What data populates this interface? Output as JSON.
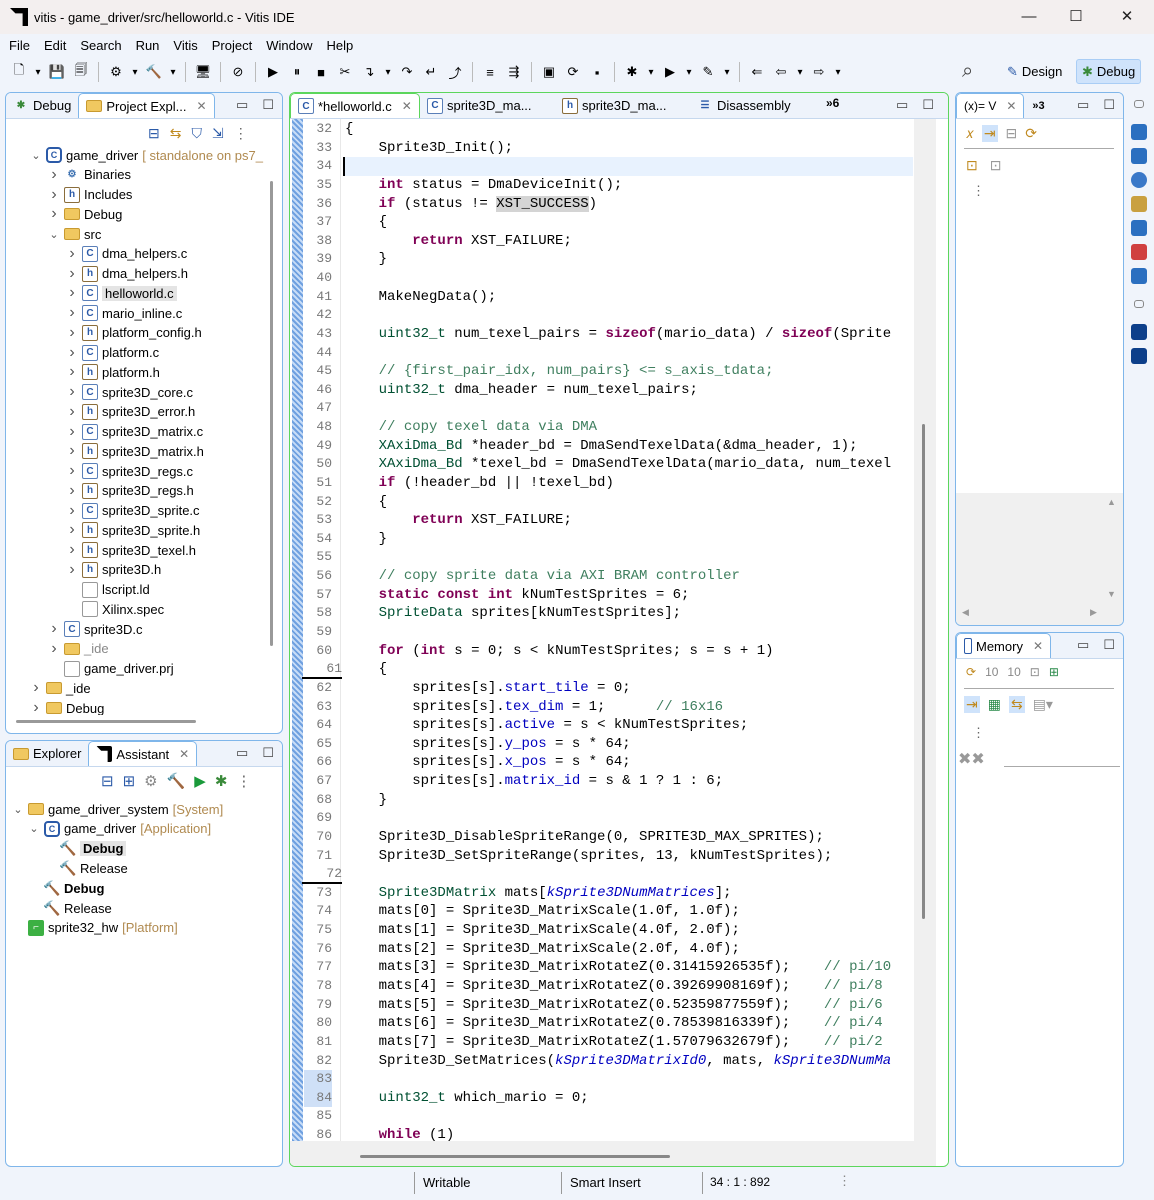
{
  "window": {
    "title": "vitis - game_driver/src/helloworld.c - Vitis IDE",
    "minimize": "—",
    "maximize": "☐",
    "close": "✕"
  },
  "menu": [
    "File",
    "Edit",
    "Search",
    "Run",
    "Vitis",
    "Project",
    "Window",
    "Help"
  ],
  "toolbar": [
    {
      "name": "new-icon",
      "glyph": "🗋"
    },
    {
      "name": "dropdown-icon",
      "glyph": "▾"
    },
    {
      "name": "save-icon",
      "glyph": "💾"
    },
    {
      "name": "save-all-icon",
      "glyph": "🗐"
    },
    {
      "sep": true
    },
    {
      "name": "target-connection-icon",
      "glyph": "⚙"
    },
    {
      "name": "dropdown-icon",
      "glyph": "▾"
    },
    {
      "name": "build-hammer-icon",
      "glyph": "🔨"
    },
    {
      "name": "dropdown-icon",
      "glyph": "▾"
    },
    {
      "sep": true
    },
    {
      "name": "terminal-monitor-icon",
      "glyph": "🖥"
    },
    {
      "sep": true
    },
    {
      "name": "skip-breakpoints-icon",
      "glyph": "⊘"
    },
    {
      "sep": true
    },
    {
      "name": "resume-icon",
      "glyph": "▶"
    },
    {
      "name": "suspend-icon",
      "glyph": "⏸"
    },
    {
      "name": "terminate-icon",
      "glyph": "■"
    },
    {
      "name": "disconnect-icon",
      "glyph": "✂"
    },
    {
      "name": "step-into-icon",
      "glyph": "↴"
    },
    {
      "name": "dropdown-icon",
      "glyph": "▾"
    },
    {
      "name": "step-over-icon",
      "glyph": "↷"
    },
    {
      "name": "step-return-icon",
      "glyph": "↵"
    },
    {
      "name": "drop-to-frame-icon",
      "glyph": "⤴"
    },
    {
      "sep": true
    },
    {
      "name": "instruction-stepping-icon",
      "glyph": "≡"
    },
    {
      "name": "use-step-filters-icon",
      "glyph": "⇶"
    },
    {
      "sep": true
    },
    {
      "name": "console-icon",
      "glyph": "▣"
    },
    {
      "name": "xsct-icon",
      "glyph": "⟳"
    },
    {
      "name": "vitis-terminal-icon",
      "glyph": "▪"
    },
    {
      "sep": true
    },
    {
      "name": "debug-bug-icon",
      "glyph": "✱"
    },
    {
      "name": "dropdown-icon",
      "glyph": "▾"
    },
    {
      "name": "run-icon",
      "glyph": "▶"
    },
    {
      "name": "dropdown-icon",
      "glyph": "▾"
    },
    {
      "name": "external-tools-icon",
      "glyph": "✎"
    },
    {
      "name": "dropdown-icon",
      "glyph": "▾"
    },
    {
      "sep": true
    },
    {
      "name": "last-edit-icon",
      "glyph": "⇐"
    },
    {
      "name": "back-icon",
      "glyph": "⇦"
    },
    {
      "name": "dropdown-icon",
      "glyph": "▾"
    },
    {
      "name": "forward-icon",
      "glyph": "⇨"
    },
    {
      "name": "dropdown-icon",
      "glyph": "▾"
    }
  ],
  "search_icon": "⌕",
  "perspectives": {
    "design": "Design",
    "debug": "Debug"
  },
  "left_top": {
    "tabs": [
      {
        "label": "Debug"
      },
      {
        "label": "Project Expl..."
      }
    ],
    "tree": [
      {
        "level": 0,
        "chev": "v",
        "icon": "proj",
        "label": "game_driver",
        "suffix": "[ standalone on ps7_"
      },
      {
        "level": 1,
        "chev": ">",
        "icon": "bin",
        "label": "Binaries"
      },
      {
        "level": 1,
        "chev": ">",
        "icon": "h",
        "label": "Includes"
      },
      {
        "level": 1,
        "chev": ">",
        "icon": "folder",
        "label": "Debug"
      },
      {
        "level": 1,
        "chev": "v",
        "icon": "folder",
        "label": "src"
      },
      {
        "level": 2,
        "chev": ">",
        "icon": "c",
        "label": "dma_helpers.c"
      },
      {
        "level": 2,
        "chev": ">",
        "icon": "h",
        "label": "dma_helpers.h"
      },
      {
        "level": 2,
        "chev": ">",
        "icon": "c",
        "label": "helloworld.c",
        "selected": true
      },
      {
        "level": 2,
        "chev": ">",
        "icon": "c",
        "label": "mario_inline.c"
      },
      {
        "level": 2,
        "chev": ">",
        "icon": "h",
        "label": "platform_config.h"
      },
      {
        "level": 2,
        "chev": ">",
        "icon": "c",
        "label": "platform.c"
      },
      {
        "level": 2,
        "chev": ">",
        "icon": "h",
        "label": "platform.h"
      },
      {
        "level": 2,
        "chev": ">",
        "icon": "c",
        "label": "sprite3D_core.c"
      },
      {
        "level": 2,
        "chev": ">",
        "icon": "h",
        "label": "sprite3D_error.h"
      },
      {
        "level": 2,
        "chev": ">",
        "icon": "c",
        "label": "sprite3D_matrix.c"
      },
      {
        "level": 2,
        "chev": ">",
        "icon": "h",
        "label": "sprite3D_matrix.h"
      },
      {
        "level": 2,
        "chev": ">",
        "icon": "c",
        "label": "sprite3D_regs.c"
      },
      {
        "level": 2,
        "chev": ">",
        "icon": "h",
        "label": "sprite3D_regs.h"
      },
      {
        "level": 2,
        "chev": ">",
        "icon": "c",
        "label": "sprite3D_sprite.c"
      },
      {
        "level": 2,
        "chev": ">",
        "icon": "h",
        "label": "sprite3D_sprite.h"
      },
      {
        "level": 2,
        "chev": ">",
        "icon": "h",
        "label": "sprite3D_texel.h"
      },
      {
        "level": 2,
        "chev": ">",
        "icon": "h",
        "label": "sprite3D.h"
      },
      {
        "level": 2,
        "chev": "",
        "icon": "file",
        "label": "lscript.ld"
      },
      {
        "level": 2,
        "chev": "",
        "icon": "file",
        "label": "Xilinx.spec"
      },
      {
        "level": 1,
        "chev": ">",
        "icon": "c",
        "label": "sprite3D.c"
      },
      {
        "level": 1,
        "chev": ">",
        "icon": "folder",
        "label": "_ide",
        "dim": true
      },
      {
        "level": 1,
        "chev": "",
        "icon": "file",
        "label": "game_driver.prj"
      },
      {
        "level": 0,
        "chev": ">",
        "icon": "folder",
        "label": "_ide"
      },
      {
        "level": 0,
        "chev": ">",
        "icon": "folder",
        "label": "Debug"
      }
    ]
  },
  "left_bottom": {
    "tabs": [
      {
        "label": "Explorer"
      },
      {
        "label": "Assistant"
      }
    ],
    "tree": [
      {
        "level": 0,
        "chev": "v",
        "icon": "folder",
        "label": "game_driver_system",
        "suffix": "[System]"
      },
      {
        "level": 1,
        "chev": "v",
        "icon": "proj",
        "label": "game_driver",
        "suffix": "[Application]"
      },
      {
        "level": 2,
        "chev": "",
        "icon": "hammer",
        "label": "Debug",
        "bold": true,
        "selected": true
      },
      {
        "level": 2,
        "chev": "",
        "icon": "hammer",
        "label": "Release"
      },
      {
        "level": 1,
        "chev": "",
        "icon": "hammer",
        "label": "Debug",
        "bold": true
      },
      {
        "level": 1,
        "chev": "",
        "icon": "hammer",
        "label": "Release"
      },
      {
        "level": 0,
        "chev": "",
        "icon": "plat",
        "label": "sprite32_hw",
        "suffix": "[Platform]"
      }
    ]
  },
  "editor": {
    "tabs": [
      {
        "label": "*helloworld.c",
        "icon": "c"
      },
      {
        "label": "sprite3D_ma...",
        "icon": "c"
      },
      {
        "label": "sprite3D_ma...",
        "icon": "h"
      },
      {
        "label": "Disassembly",
        "icon": "dis"
      }
    ],
    "overflow": "»6",
    "current_line": 34,
    "lines": [
      {
        "n": 32,
        "t": [
          [
            "",
            "{"
          ]
        ]
      },
      {
        "n": 33,
        "t": [
          [
            "",
            "    Sprite3D_Init();"
          ]
        ]
      },
      {
        "n": 34,
        "t": []
      },
      {
        "n": 35,
        "t": [
          [
            "",
            "    "
          ],
          [
            "k",
            "int"
          ],
          [
            "",
            " status = DmaDeviceInit();"
          ]
        ]
      },
      {
        "n": 36,
        "t": [
          [
            "",
            "    "
          ],
          [
            "k",
            "if"
          ],
          [
            "",
            " (status != "
          ],
          [
            "hl",
            "XST_SUCCESS"
          ],
          [
            "",
            ")"
          ]
        ]
      },
      {
        "n": 37,
        "t": [
          [
            "",
            "    {"
          ]
        ]
      },
      {
        "n": 38,
        "t": [
          [
            "",
            "        "
          ],
          [
            "k",
            "return"
          ],
          [
            "",
            " XST_FAILURE;"
          ]
        ]
      },
      {
        "n": 39,
        "t": [
          [
            "",
            "    }"
          ]
        ]
      },
      {
        "n": 40,
        "t": []
      },
      {
        "n": 41,
        "t": [
          [
            "",
            "    MakeNegData();"
          ]
        ]
      },
      {
        "n": 42,
        "t": []
      },
      {
        "n": 43,
        "t": [
          [
            "",
            "    "
          ],
          [
            "ty",
            "uint32_t"
          ],
          [
            "",
            " num_texel_pairs = "
          ],
          [
            "k",
            "sizeof"
          ],
          [
            "",
            "(mario_data) / "
          ],
          [
            "k",
            "sizeof"
          ],
          [
            "",
            "(Sprite"
          ]
        ]
      },
      {
        "n": 44,
        "t": []
      },
      {
        "n": 45,
        "t": [
          [
            "",
            "    "
          ],
          [
            "cm",
            "// {first_pair_idx, num_pairs} <= s_axis_tdata;"
          ]
        ]
      },
      {
        "n": 46,
        "t": [
          [
            "",
            "    "
          ],
          [
            "ty",
            "uint32_t"
          ],
          [
            "",
            " dma_header = num_texel_pairs;"
          ]
        ]
      },
      {
        "n": 47,
        "t": []
      },
      {
        "n": 48,
        "t": [
          [
            "",
            "    "
          ],
          [
            "cm",
            "// copy texel data via DMA"
          ]
        ]
      },
      {
        "n": 49,
        "t": [
          [
            "",
            "    "
          ],
          [
            "ty",
            "XAxiDma_Bd"
          ],
          [
            "",
            " *header_bd = DmaSendTexelData(&dma_header, 1);"
          ]
        ]
      },
      {
        "n": 50,
        "t": [
          [
            "",
            "    "
          ],
          [
            "ty",
            "XAxiDma_Bd"
          ],
          [
            "",
            " *texel_bd = DmaSendTexelData(mario_data, num_texel"
          ]
        ]
      },
      {
        "n": 51,
        "t": [
          [
            "",
            "    "
          ],
          [
            "k",
            "if"
          ],
          [
            "",
            " (!header_bd || !texel_bd)"
          ]
        ]
      },
      {
        "n": 52,
        "t": [
          [
            "",
            "    {"
          ]
        ]
      },
      {
        "n": 53,
        "t": [
          [
            "",
            "        "
          ],
          [
            "k",
            "return"
          ],
          [
            "",
            " XST_FAILURE;"
          ]
        ]
      },
      {
        "n": 54,
        "t": [
          [
            "",
            "    }"
          ]
        ]
      },
      {
        "n": 55,
        "t": []
      },
      {
        "n": 56,
        "t": [
          [
            "",
            "    "
          ],
          [
            "cm",
            "// copy sprite data via AXI BRAM controller"
          ]
        ]
      },
      {
        "n": 57,
        "t": [
          [
            "",
            "    "
          ],
          [
            "k",
            "static const int"
          ],
          [
            "",
            " kNumTestSprites = 6;"
          ]
        ]
      },
      {
        "n": 58,
        "t": [
          [
            "",
            "    "
          ],
          [
            "ty",
            "SpriteData"
          ],
          [
            "",
            " sprites[kNumTestSprites];"
          ]
        ]
      },
      {
        "n": 59,
        "t": []
      },
      {
        "n": 60,
        "t": [
          [
            "",
            "    "
          ],
          [
            "k",
            "for"
          ],
          [
            "",
            " ("
          ],
          [
            "k",
            "int"
          ],
          [
            "",
            " s = 0; s < kNumTestSprites; s = s + 1)"
          ]
        ]
      },
      {
        "n": 61,
        "t": [
          [
            "",
            "    {"
          ]
        ]
      },
      {
        "n": 62,
        "t": [
          [
            "",
            "        sprites[s]."
          ],
          [
            "fd",
            "start_tile"
          ],
          [
            "",
            " = 0;"
          ]
        ]
      },
      {
        "n": 63,
        "t": [
          [
            "",
            "        sprites[s]."
          ],
          [
            "fd",
            "tex_dim"
          ],
          [
            "",
            " = 1;      "
          ],
          [
            "cm",
            "// 16x16"
          ]
        ]
      },
      {
        "n": 64,
        "t": [
          [
            "",
            "        sprites[s]."
          ],
          [
            "fd",
            "active"
          ],
          [
            "",
            " = s < kNumTestSprites;"
          ]
        ]
      },
      {
        "n": 65,
        "t": [
          [
            "",
            "        sprites[s]."
          ],
          [
            "fd",
            "y_pos"
          ],
          [
            "",
            " = s * 64;"
          ]
        ]
      },
      {
        "n": 66,
        "t": [
          [
            "",
            "        sprites[s]."
          ],
          [
            "fd",
            "x_pos"
          ],
          [
            "",
            " = s * 64;"
          ]
        ]
      },
      {
        "n": 67,
        "t": [
          [
            "",
            "        sprites[s]."
          ],
          [
            "fd",
            "matrix_id"
          ],
          [
            "",
            " = s & 1 ? 1 : 6;"
          ]
        ]
      },
      {
        "n": 68,
        "t": [
          [
            "",
            "    }"
          ]
        ]
      },
      {
        "n": 69,
        "t": []
      },
      {
        "n": 70,
        "t": [
          [
            "",
            "    Sprite3D_DisableSpriteRange(0, SPRITE3D_MAX_SPRITES);"
          ]
        ]
      },
      {
        "n": 71,
        "t": [
          [
            "",
            "    Sprite3D_SetSpriteRange(sprites, 13, kNumTestSprites);"
          ]
        ]
      },
      {
        "n": 72,
        "t": []
      },
      {
        "n": 73,
        "t": [
          [
            "",
            "    "
          ],
          [
            "ty",
            "Sprite3DMatrix"
          ],
          [
            "",
            " mats["
          ],
          [
            "mc",
            "kSprite3DNumMatrices"
          ],
          [
            "",
            "];"
          ]
        ]
      },
      {
        "n": 74,
        "t": [
          [
            "",
            "    mats[0] = Sprite3D_MatrixScale(1.0f, 1.0f);"
          ]
        ]
      },
      {
        "n": 75,
        "t": [
          [
            "",
            "    mats[1] = Sprite3D_MatrixScale(4.0f, 2.0f);"
          ]
        ]
      },
      {
        "n": 76,
        "t": [
          [
            "",
            "    mats[2] = Sprite3D_MatrixScale(2.0f, 4.0f);"
          ]
        ]
      },
      {
        "n": 77,
        "t": [
          [
            "",
            "    mats[3] = Sprite3D_MatrixRotateZ(0.31415926535f);    "
          ],
          [
            "cm",
            "// pi/10"
          ]
        ]
      },
      {
        "n": 78,
        "t": [
          [
            "",
            "    mats[4] = Sprite3D_MatrixRotateZ(0.39269908169f);    "
          ],
          [
            "cm",
            "// pi/8"
          ]
        ]
      },
      {
        "n": 79,
        "t": [
          [
            "",
            "    mats[5] = Sprite3D_MatrixRotateZ(0.52359877559f);    "
          ],
          [
            "cm",
            "// pi/6"
          ]
        ]
      },
      {
        "n": 80,
        "t": [
          [
            "",
            "    mats[6] = Sprite3D_MatrixRotateZ(0.78539816339f);    "
          ],
          [
            "cm",
            "// pi/4"
          ]
        ]
      },
      {
        "n": 81,
        "t": [
          [
            "",
            "    mats[7] = Sprite3D_MatrixRotateZ(1.57079632679f);    "
          ],
          [
            "cm",
            "// pi/2"
          ]
        ]
      },
      {
        "n": 82,
        "t": [
          [
            "",
            "    Sprite3D_SetMatrices("
          ],
          [
            "mc",
            "kSprite3DMatrixId0"
          ],
          [
            "",
            ", mats, "
          ],
          [
            "mc",
            "kSprite3DNumMa"
          ]
        ]
      },
      {
        "n": 83,
        "t": []
      },
      {
        "n": 84,
        "t": [
          [
            "",
            "    "
          ],
          [
            "ty",
            "uint32_t"
          ],
          [
            "",
            " which_mario = 0;"
          ]
        ]
      },
      {
        "n": 85,
        "t": []
      },
      {
        "n": 86,
        "t": [
          [
            "",
            "    "
          ],
          [
            "k",
            "while"
          ],
          [
            "",
            " (1)"
          ]
        ]
      }
    ]
  },
  "variables": {
    "tab": "(x)= V",
    "overflow": "»3"
  },
  "memory": {
    "tab": "Memory"
  },
  "right_strip": [
    "restore-icon",
    "monitor-icon",
    "monitor-icon",
    "play-icon",
    "java-icon",
    "registers-icon",
    "breakpoints-icon",
    "debug-view-icon",
    "restore-icon",
    "terminal-icon",
    "terminal-icon"
  ],
  "status": {
    "writable": "Writable",
    "insert_mode": "Smart Insert",
    "position": "34 : 1 : 892"
  },
  "colors": {
    "keyword": "#7f0055",
    "type": "#005032",
    "comment": "#3f7f5f",
    "field": "#0000c0",
    "panel_border": "#7fb6ea",
    "editor_border": "#5cd65c"
  }
}
